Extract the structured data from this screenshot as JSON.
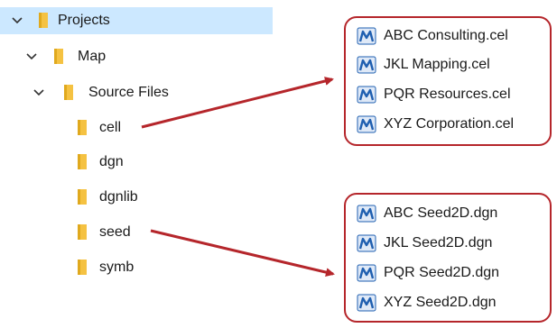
{
  "tree": [
    {
      "label": "Projects",
      "expanded": true,
      "selected": true
    },
    {
      "label": "Map",
      "expanded": true
    },
    {
      "label": "Source Files",
      "expanded": true
    },
    {
      "label": "cell"
    },
    {
      "label": "dgn"
    },
    {
      "label": "dgnlib"
    },
    {
      "label": "seed"
    },
    {
      "label": "symb"
    }
  ],
  "cell_files": [
    {
      "label": "ABC Consulting.cel"
    },
    {
      "label": "JKL Mapping.cel"
    },
    {
      "label": "PQR Resources.cel"
    },
    {
      "label": "XYZ Corporation.cel"
    }
  ],
  "seed_files": [
    {
      "label": "ABC Seed2D.dgn"
    },
    {
      "label": "JKL Seed2D.dgn"
    },
    {
      "label": "PQR Seed2D.dgn"
    },
    {
      "label": "XYZ Seed2D.dgn"
    }
  ],
  "colors": {
    "selection": "#cce8ff",
    "folder": "#f5c242",
    "arrow": "#b5262b",
    "file_icon": "#1f5fb0"
  },
  "icons": {
    "folder": "folder-icon",
    "chevron": "chevron-down-icon",
    "file": "microstation-file-icon",
    "arrow": "arrow-icon"
  }
}
